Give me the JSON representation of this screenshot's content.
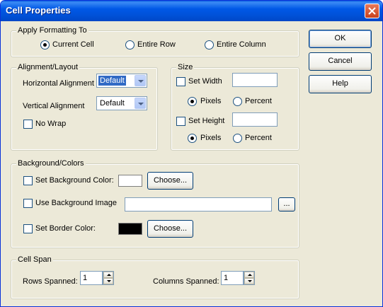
{
  "window": {
    "title": "Cell Properties"
  },
  "apply_formatting": {
    "legend": "Apply Formatting To",
    "options": [
      "Current Cell",
      "Entire Row",
      "Entire Column"
    ],
    "selected": "Current Cell"
  },
  "alignment": {
    "legend": "Alignment/Layout",
    "horizontal_label": "Horizontal Alignment",
    "horizontal_value": "Default",
    "vertical_label": "Vertical Alignment",
    "vertical_value": "Default",
    "nowrap_label": "No Wrap",
    "nowrap_checked": false
  },
  "size": {
    "legend": "Size",
    "width_label": "Set Width",
    "width_value": "",
    "width_unit_options": [
      "Pixels",
      "Percent"
    ],
    "width_unit_selected": "Pixels",
    "height_label": "Set Height",
    "height_value": "",
    "height_unit_options": [
      "Pixels",
      "Percent"
    ],
    "height_unit_selected": "Pixels"
  },
  "background": {
    "legend": "Background/Colors",
    "bg_color_label": "Set Background Color:",
    "bg_color_value": "#ffffff",
    "choose_label": "Choose...",
    "bg_image_label": "Use Background Image",
    "bg_image_value": "",
    "browse_label": "...",
    "border_color_label": "Set Border Color:",
    "border_color_value": "#000000"
  },
  "cell_span": {
    "legend": "Cell Span",
    "rows_label": "Rows Spanned:",
    "rows_value": "1",
    "cols_label": "Columns Spanned:",
    "cols_value": "1"
  },
  "buttons": {
    "ok": "OK",
    "cancel": "Cancel",
    "help": "Help"
  },
  "colors": {
    "titlebar": "#0058e6",
    "dialog": "#ece9d8",
    "selection": "#316ac5"
  },
  "icons": {
    "close": "close-icon"
  }
}
